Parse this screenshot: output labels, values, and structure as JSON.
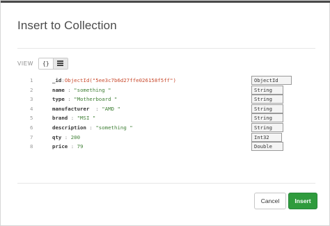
{
  "dialog": {
    "title": "Insert to Collection",
    "view_label": "VIEW",
    "view_modes": [
      {
        "label": "{}",
        "active": false
      },
      {
        "label": "list",
        "active": true
      }
    ]
  },
  "document": [
    {
      "line": "1",
      "key": "_id",
      "value": "ObjectId(\"5ee3c7b6d27ffe026158f5ff\")",
      "value_kind": "oid",
      "type": "ObjectId"
    },
    {
      "line": "2",
      "key": "name",
      "value": "\"something \"",
      "value_kind": "str",
      "type": "String"
    },
    {
      "line": "3",
      "key": "type",
      "value": "\"Motherboard \"",
      "value_kind": "str",
      "type": "String"
    },
    {
      "line": "4",
      "key": "manufacturer",
      "value": "\"AMD \"",
      "value_kind": "str",
      "type": "String"
    },
    {
      "line": "5",
      "key": "brand",
      "value": "\"MSI \"",
      "value_kind": "str",
      "type": "String"
    },
    {
      "line": "6",
      "key": "description",
      "value": "\"something \"",
      "value_kind": "str",
      "type": "String"
    },
    {
      "line": "7",
      "key": "qty",
      "value": "200",
      "value_kind": "num",
      "type": "Int32"
    },
    {
      "line": "8",
      "key": "price",
      "value": "79",
      "value_kind": "num",
      "type": "Double"
    }
  ],
  "footer": {
    "cancel_label": "Cancel",
    "insert_label": "Insert"
  },
  "colors": {
    "insert_button": "#2f9b3d",
    "string_value": "#3f7f35",
    "objectid_value": "#c8482b"
  }
}
